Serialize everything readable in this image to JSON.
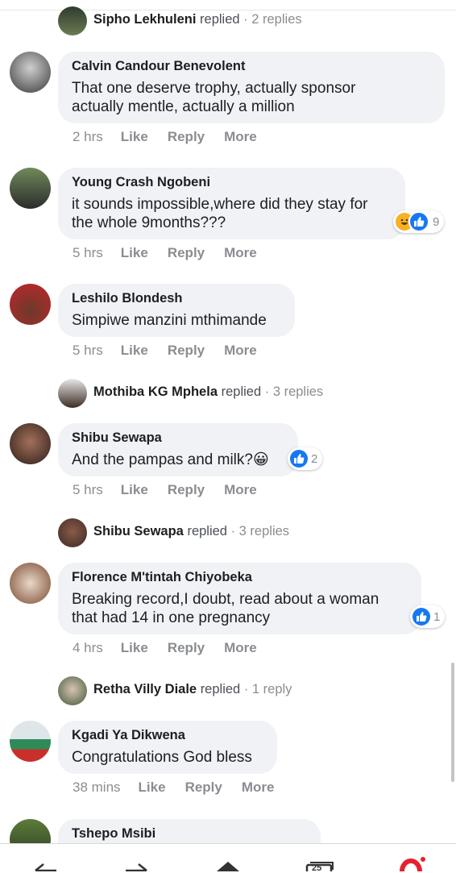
{
  "replies_summary": [
    {
      "name": "Sipho Lekhuleni",
      "replied": "replied",
      "count": "· 2 replies"
    },
    {
      "name": "Mothiba KG Mphela",
      "replied": "replied",
      "count": "· 3 replies"
    },
    {
      "name": "Shibu Sewapa",
      "replied": "replied",
      "count": "· 3 replies"
    },
    {
      "name": "Retha Villy Diale",
      "replied": "replied",
      "count": "· 1 reply"
    }
  ],
  "comments": [
    {
      "author": "Calvin Candour Benevolent",
      "text": "That one deserve trophy, actually sponsor\nactually mentle, actually a million",
      "time": "2 hrs",
      "like": "Like",
      "reply": "Reply",
      "more": "More"
    },
    {
      "author": "Young Crash Ngobeni",
      "text": "it sounds impossible,where did they stay for\nthe whole 9months???",
      "time": "5 hrs",
      "like": "Like",
      "reply": "Reply",
      "more": "More",
      "reaction_count": "9"
    },
    {
      "author": "Leshilo Blondesh",
      "text": "Simpiwe manzini mthimande",
      "time": "5 hrs",
      "like": "Like",
      "reply": "Reply",
      "more": "More"
    },
    {
      "author": "Shibu Sewapa",
      "text": "And the pampas and milk?😀",
      "time": "5 hrs",
      "like": "Like",
      "reply": "Reply",
      "more": "More",
      "reaction_count": "2"
    },
    {
      "author": "Florence M'tintah Chiyobeka",
      "text": "Breaking record,I doubt, read about a woman\nthat had 14 in one pregnancy",
      "time": "4 hrs",
      "like": "Like",
      "reply": "Reply",
      "more": "More",
      "reaction_count": "1"
    },
    {
      "author": "Kgadi Ya Dikwena",
      "text": "Congratulations God bless",
      "time": "38 mins",
      "like": "Like",
      "reply": "Reply",
      "more": "More"
    },
    {
      "author": "Tshepo Msibi",
      "text": ""
    }
  ],
  "nav": {
    "tabs_count": "25"
  },
  "colors": {
    "like_blue": "#1877f2",
    "haha_yellow": "#f7b125",
    "opera_red": "#e3222f"
  }
}
